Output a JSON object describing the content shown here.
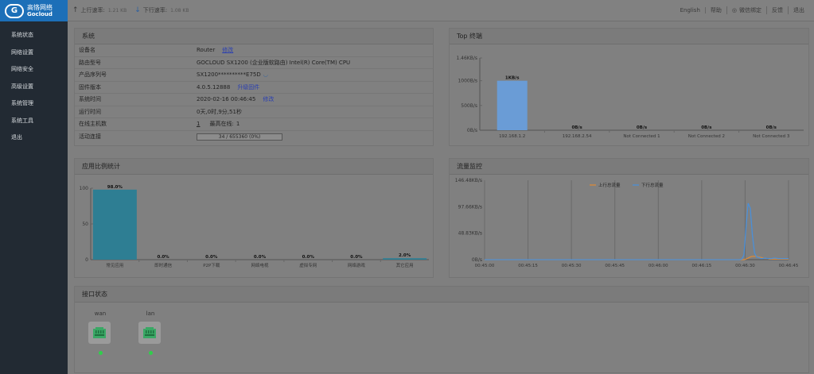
{
  "brand": {
    "line1": "高恪网络",
    "line2": "Gocloud"
  },
  "topbar": {
    "up_label": "上行速率:",
    "up_value": "1.21 KB",
    "down_label": "下行速率:",
    "down_value": "1.08 KB",
    "links": [
      "English",
      "帮助",
      "微信绑定",
      "反馈",
      "退出"
    ]
  },
  "sidebar": {
    "items": [
      "系统状态",
      "网络设置",
      "网络安全",
      "高级设置",
      "系统管理",
      "系统工具",
      "退出"
    ]
  },
  "system": {
    "title": "系统",
    "rows": [
      {
        "k": "设备名",
        "v": "Router",
        "link": "修改"
      },
      {
        "k": "路由型号",
        "v": "GOCLOUD SX1200 (企业版软路由) Intel(R) Core(TM) CPU"
      },
      {
        "k": "产品序列号",
        "v": "SX1200**********E75D"
      },
      {
        "k": "固件版本",
        "v": "4.0.5.12888",
        "link": "升级固件"
      },
      {
        "k": "系统时间",
        "v": "2020-02-16 00:46:45",
        "link": "修改"
      },
      {
        "k": "运行时间",
        "v": "0天,0时,9分,51秒"
      },
      {
        "k": "在线主机数",
        "v": "1",
        "extra_label": "最高在线:",
        "extra_value": "1"
      },
      {
        "k": "活动连接",
        "progress_text": "34 / 655360 (0%)",
        "progress": 0.0
      }
    ]
  },
  "top_terminal": {
    "title": "Top 终端"
  },
  "app_stats": {
    "title": "应用比例统计"
  },
  "traffic": {
    "title": "流量监控"
  },
  "interfaces": {
    "title": "接口状态",
    "items": [
      {
        "name": "wan",
        "status_color": "#2fcf4b"
      },
      {
        "name": "lan",
        "status_color": "#2fcf4b"
      }
    ]
  },
  "chart_data": [
    {
      "type": "bar",
      "title": "Top 终端",
      "categories": [
        "192.168.1.2",
        "192.168.2.54",
        "Not Connected 1",
        "Not Connected 2",
        "Not Connected 3"
      ],
      "values": [
        1000,
        0,
        0,
        0,
        0
      ],
      "value_labels": [
        "1KB/s",
        "0B/s",
        "0B/s",
        "0B/s",
        "0B/s"
      ],
      "ylim": [
        0,
        1460
      ],
      "yticks": [
        0,
        500,
        1000,
        1460
      ],
      "ytick_labels": [
        "0B/s",
        "500B/s",
        "1000B/s",
        "1.46KB/s"
      ],
      "color": "#6a9cd6"
    },
    {
      "type": "bar",
      "title": "应用比例统计",
      "categories": [
        "常见应用",
        "即时通信",
        "P2P下载",
        "网络电视",
        "虚拟专网",
        "网络游戏",
        "其它应用"
      ],
      "values": [
        98.0,
        0.0,
        0.0,
        0.0,
        0.0,
        0.0,
        2.0
      ],
      "value_labels": [
        "98.0%",
        "0.0%",
        "0.0%",
        "0.0%",
        "0.0%",
        "0.0%",
        "2.0%"
      ],
      "ylim": [
        0,
        100
      ],
      "yticks": [
        0,
        50,
        100
      ],
      "color": "#2e7e93"
    },
    {
      "type": "line",
      "title": "流量监控",
      "x": [
        "00:45:00",
        "00:45:15",
        "00:45:30",
        "00:45:45",
        "00:46:00",
        "00:46:15",
        "00:46:30",
        "00:46:45"
      ],
      "ylim": [
        0,
        146.48
      ],
      "yticks": [
        0,
        48.83,
        97.66,
        146.48
      ],
      "ytick_labels": [
        "0B/s",
        "48.83KB/s",
        "97.66KB/s",
        "146.48KB/s"
      ],
      "legend_position": "top",
      "series": [
        {
          "name": "上行总流量",
          "color": "#d98a3a",
          "values": [
            0,
            0,
            0,
            0,
            0,
            0,
            0,
            0,
            0,
            0,
            0,
            0,
            0,
            0,
            0,
            0,
            0,
            0,
            0,
            0,
            0,
            0,
            0,
            0,
            0,
            0,
            0,
            0,
            0,
            0,
            0,
            0,
            0,
            0,
            0,
            0,
            0,
            0,
            0,
            0,
            0,
            0,
            0,
            0,
            0,
            0,
            0,
            0,
            0,
            0,
            0,
            0,
            0,
            0,
            0,
            0,
            0,
            0,
            0,
            0,
            0,
            0,
            0,
            0,
            0,
            0,
            0,
            0,
            0,
            0,
            0,
            0,
            0,
            0,
            0,
            0,
            0,
            0,
            0,
            0,
            0,
            0,
            0,
            0,
            0,
            0,
            0,
            0,
            0,
            0,
            0,
            0,
            0,
            0,
            0,
            0,
            0,
            0,
            0,
            0,
            0,
            0,
            0,
            0,
            0,
            0,
            0,
            0,
            0,
            0,
            0,
            0,
            0,
            0,
            0,
            0,
            0,
            0,
            0,
            0,
            0,
            0,
            0,
            1,
            3,
            5,
            6,
            6,
            6,
            5,
            4,
            3,
            2,
            2,
            1,
            1,
            1,
            1,
            1,
            1,
            1,
            1,
            1,
            1
          ]
        },
        {
          "name": "下行总流量",
          "color": "#4a8fd8",
          "values": [
            0,
            0,
            0,
            0,
            0,
            0,
            0,
            0,
            0,
            0,
            0,
            0,
            0,
            0,
            0,
            0,
            0,
            0,
            0,
            0,
            0,
            0,
            0,
            0,
            0,
            0,
            0,
            0,
            0,
            0,
            0,
            0,
            0,
            0,
            0,
            0,
            0,
            0,
            0,
            0,
            0,
            0,
            0,
            0,
            0,
            0,
            0,
            0,
            0,
            0,
            0,
            0,
            0,
            0,
            0,
            0,
            0,
            0,
            0,
            0,
            0,
            0,
            0,
            0,
            0,
            0,
            0,
            0,
            0,
            0,
            0,
            0,
            0,
            0,
            0,
            0,
            0,
            0,
            0,
            0,
            0,
            0,
            0,
            0,
            0,
            0,
            0,
            0,
            0,
            0,
            0,
            0,
            0,
            0,
            0,
            0,
            0,
            0,
            0,
            0,
            0,
            0,
            0,
            0,
            0,
            0,
            0,
            0,
            0,
            0,
            0,
            0,
            0,
            0,
            0,
            0,
            0,
            0,
            0,
            0,
            0,
            1,
            8,
            60,
            104,
            95,
            45,
            12,
            5,
            4,
            2,
            2,
            3,
            2,
            2,
            2,
            3,
            3,
            2,
            2,
            2,
            2,
            2,
            2
          ]
        }
      ]
    }
  ]
}
